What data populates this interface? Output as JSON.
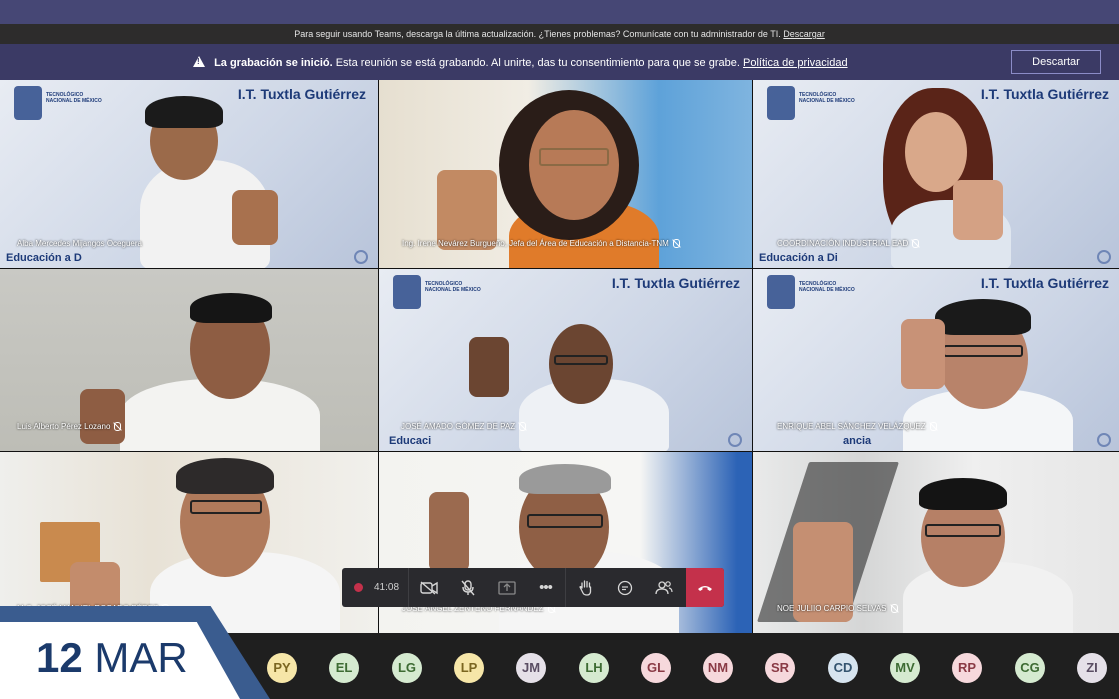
{
  "update_bar": {
    "text": "Para seguir usando Teams, descarga la última actualización. ¿Tienes problemas? Comunícate con tu administrador de TI.",
    "link": "Descargar"
  },
  "recording_bar": {
    "bold": "La grabación se inició.",
    "text": "Esta reunión se está grabando. Al unirte, das tu consentimiento para que se grabe.",
    "link": "Política de privacidad",
    "dismiss": "Descartar"
  },
  "branding": {
    "institution": "I.T. Tuxtla Gutiérrez",
    "tecnm": "TECNOLÓGICO NACIONAL DE MÉXICO",
    "edu1": "Educación a D",
    "edu2": "Educación a Di",
    "edu3": "Educaci",
    "edu4": "ancia"
  },
  "participants": [
    {
      "name": "Alba Mercedes Mijangos Oceguera",
      "muted": false
    },
    {
      "name": "Ing. Irene Nevárez Burgueño, Jefa del Área de Educación a Distancia-TNM",
      "muted": true
    },
    {
      "name": "COORDINACIÓN INDUSTRIAL EAD",
      "muted": true
    },
    {
      "name": "Luis Alberto Pérez Lozano",
      "muted": true
    },
    {
      "name": "JOSÉ AMADO GÓMEZ DE PAZ",
      "muted": true
    },
    {
      "name": "ENRIQUE ABEL SÁNCHEZ VELÁZQUEZ",
      "muted": true
    },
    {
      "name": "M.C. JOSÉ MANUEL ROSADO PÉREZ",
      "muted": true
    },
    {
      "name": "JOSÉ ÁNGEL ZENTENO FERNÁNDEZ",
      "muted": true
    },
    {
      "name": "NOE JULIIO CARPIO SELVAS",
      "muted": true
    }
  ],
  "controls": {
    "timer": "41:08",
    "icons": [
      "record-icon",
      "camera-off-icon",
      "mic-off-icon",
      "share-icon",
      "more-icon",
      "raise-hand-icon",
      "chat-icon",
      "participants-icon",
      "hang-up-icon"
    ],
    "colors": {
      "hangup": "#c4314b"
    }
  },
  "date_banner": {
    "day": "12",
    "month": "MAR"
  },
  "avatars": [
    {
      "initials": "PY",
      "bg": "#f6e6a8",
      "fg": "#7a6520"
    },
    {
      "initials": "EL",
      "bg": "#d5ead0",
      "fg": "#3d6b33"
    },
    {
      "initials": "LG",
      "bg": "#d5ead0",
      "fg": "#3d6b33"
    },
    {
      "initials": "LP",
      "bg": "#f6e6a8",
      "fg": "#7a6520"
    },
    {
      "initials": "JM",
      "bg": "#e5e0e8",
      "fg": "#5a4d63"
    },
    {
      "initials": "LH",
      "bg": "#d5ead0",
      "fg": "#3d6b33"
    },
    {
      "initials": "GL",
      "bg": "#f6d8dc",
      "fg": "#8a3a45"
    },
    {
      "initials": "NM",
      "bg": "#f6d8dc",
      "fg": "#8a3a45"
    },
    {
      "initials": "SR",
      "bg": "#f6d8dc",
      "fg": "#8a3a45"
    },
    {
      "initials": "CD",
      "bg": "#d7e4ef",
      "fg": "#34546f"
    },
    {
      "initials": "MV",
      "bg": "#d5ead0",
      "fg": "#3d6b33"
    },
    {
      "initials": "RP",
      "bg": "#f6d8dc",
      "fg": "#8a3a45"
    },
    {
      "initials": "CG",
      "bg": "#d5ead0",
      "fg": "#3d6b33"
    },
    {
      "initials": "ZI",
      "bg": "#e5e0e8",
      "fg": "#5a4d63"
    }
  ]
}
